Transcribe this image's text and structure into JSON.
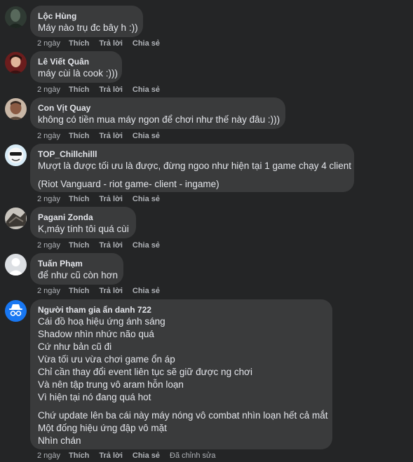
{
  "actions": {
    "like": "Thích",
    "reply": "Trả lời",
    "share": "Chia sẻ"
  },
  "comments": [
    {
      "author": "Lộc Hùng",
      "lines": [
        "Máy nào trụ đc bây h :))"
      ],
      "time": "2 ngày"
    },
    {
      "author": "Lê Viết Quân",
      "lines": [
        "máy cùi là cook :)))"
      ],
      "time": "2 ngày"
    },
    {
      "author": "Con Vịt Quay",
      "lines": [
        "không có tiền mua máy ngon để chơi như thế này đâu :)))"
      ],
      "time": "2 ngày"
    },
    {
      "author": "TOP_Chillchilll",
      "lines": [
        "Mượt là được tối ưu là được, đừng ngoo như hiện tại 1 game chạy 4 client",
        "(Riot Vanguard - riot game- client - ingame)"
      ],
      "time": "2 ngày"
    },
    {
      "author": "Pagani Zonda",
      "lines": [
        "K,máy tính tôi quá cùi"
      ],
      "time": "2 ngày"
    },
    {
      "author": "Tuấn Phạm",
      "lines": [
        "để như cũ còn hơn"
      ],
      "time": "2 ngày"
    },
    {
      "author": "Người tham gia ẩn danh 722",
      "lines": [
        "Cái đồ hoạ hiệu ứng ánh sáng",
        "Shadow nhìn nhức não quá",
        "Cứ như bản cũ đi",
        "Vừa tối ưu vừa chơi game ổn áp",
        "Chỉ cần thay đổi event liên tục sẽ giữ được ng chơi",
        "Và nên tập trung vô aram hỗn loạn",
        "Vì hiện tại nó đang quá hot",
        "Chứ update lên ba cái này máy nóng vô combat nhìn loạn hết cả mắt",
        "Một đống hiệu ứng đập vô mặt",
        "Nhìn chán"
      ],
      "time": "2 ngày",
      "edited": "Đã chỉnh sửa"
    }
  ]
}
